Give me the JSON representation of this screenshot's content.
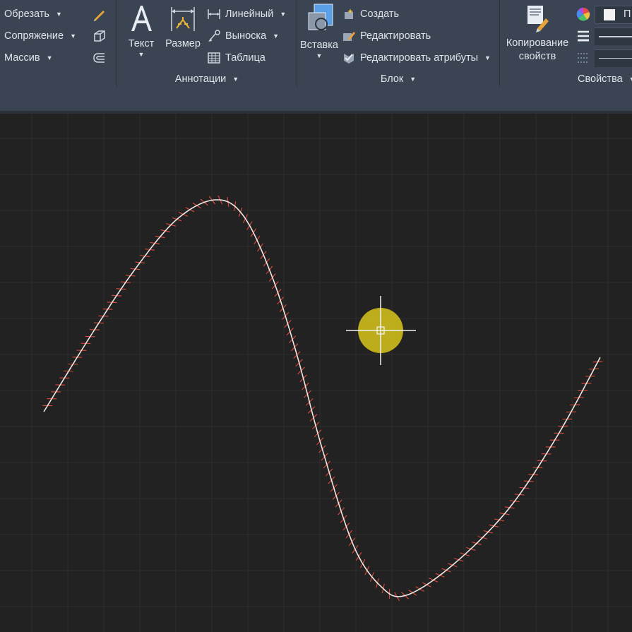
{
  "ribbon": {
    "modify": {
      "trim": "Обрезать",
      "fillet": "Сопряжение",
      "array": "Массив"
    },
    "annotation": {
      "title": "Аннотации",
      "text": "Текст",
      "dimension": "Размер",
      "linear": "Линейный",
      "leader": "Выноска",
      "table": "Таблица"
    },
    "block": {
      "title": "Блок",
      "insert": "Вставка",
      "create": "Создать",
      "edit": "Редактировать",
      "edit_attributes": "Редактировать атрибуты"
    },
    "properties": {
      "title": "Свойства",
      "match_line1": "Копирование",
      "match_line2": "свойств",
      "bylayer_fragment": "П"
    }
  },
  "colors": {
    "ribbon_bg": "#3b4453",
    "canvas_bg": "#222222",
    "grid": "#2e2e2e",
    "curve": "#f2e6e2",
    "hatch": "#e0493a",
    "cursor_highlight": "#d8c51b"
  }
}
